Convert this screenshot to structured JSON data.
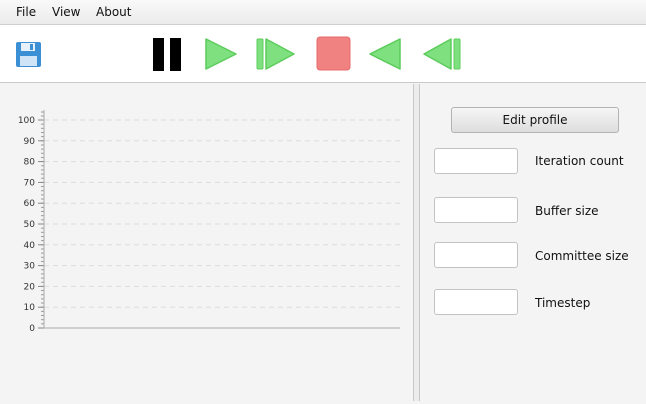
{
  "menu": {
    "items": [
      "File",
      "View",
      "About"
    ]
  },
  "toolbar": {
    "buttons": [
      {
        "icon": "floppy-disk-save-icon",
        "color": "#3b8fd4"
      },
      {
        "icon": "pause-icon",
        "color": "#000000"
      },
      {
        "icon": "play-icon",
        "color": "#7ee07e"
      },
      {
        "icon": "step-forward-icon",
        "color": "#7ee07e"
      },
      {
        "icon": "stop-icon",
        "color": "#f08282"
      },
      {
        "icon": "play-backward-icon",
        "color": "#7ee07e"
      },
      {
        "icon": "step-backward-icon",
        "color": "#7ee07e"
      }
    ]
  },
  "chart_data": {
    "type": "line",
    "series": [],
    "ylim": [
      0,
      100
    ],
    "yticks": [
      0,
      10,
      20,
      30,
      40,
      50,
      60,
      70,
      80,
      90,
      100
    ],
    "grid": true
  },
  "side": {
    "edit_profile_label": "Edit profile",
    "fields": [
      {
        "label": "Iteration count",
        "value": ""
      },
      {
        "label": "Buffer size",
        "value": ""
      },
      {
        "label": "Committee size",
        "value": ""
      },
      {
        "label": "Timestep",
        "value": ""
      }
    ]
  }
}
